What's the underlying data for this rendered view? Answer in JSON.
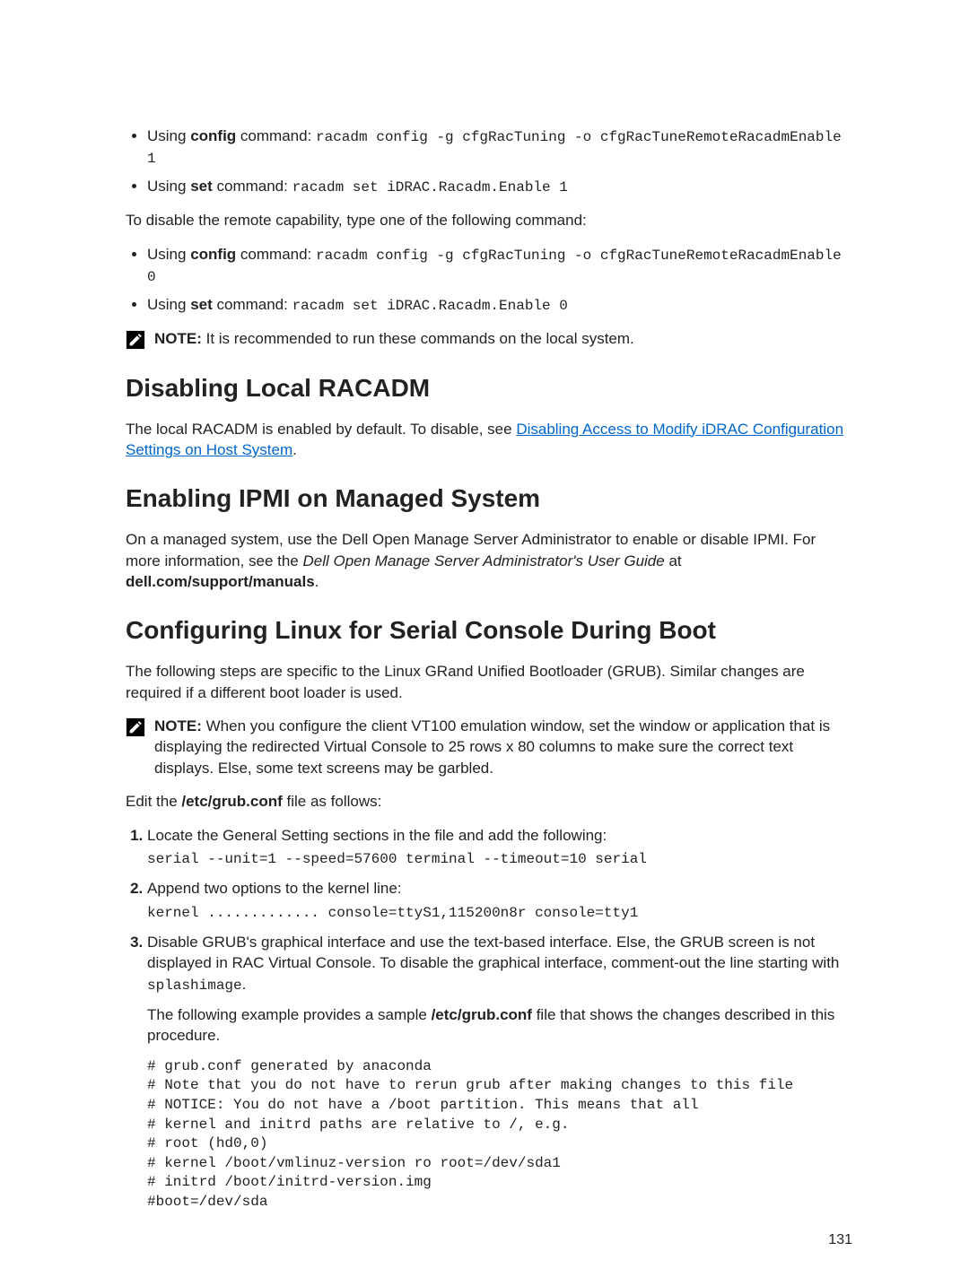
{
  "bullets_enable": [
    {
      "lead": "Using ",
      "cmd": "config",
      "rest": " command: ",
      "code": "racadm config -g cfgRacTuning -o cfgRacTuneRemoteRacadmEnable 1"
    },
    {
      "lead": "Using ",
      "cmd": "set",
      "rest": " command: ",
      "code": "racadm set iDRAC.Racadm.Enable 1"
    }
  ],
  "disable_intro": "To disable the remote capability, type one of the following command:",
  "bullets_disable": [
    {
      "lead": "Using ",
      "cmd": "config",
      "rest": " command: ",
      "code": "racadm config -g cfgRacTuning -o cfgRacTuneRemoteRacadmEnable 0"
    },
    {
      "lead": "Using ",
      "cmd": "set",
      "rest": " command: ",
      "code": "racadm set iDRAC.Racadm.Enable 0"
    }
  ],
  "note1": {
    "label": "NOTE:",
    "text": " It is recommended to run these commands on the local system."
  },
  "section1": {
    "title": "Disabling Local RACADM",
    "body_pre": "The local RACADM is enabled by default. To disable, see ",
    "link": "Disabling Access to Modify iDRAC Configuration Settings on Host System",
    "body_post": "."
  },
  "section2": {
    "title": "Enabling IPMI on Managed System",
    "body_pre": "On a managed system, use the Dell Open Manage Server Administrator to enable or disable IPMI. For more information, see the ",
    "italic": "Dell Open Manage Server Administrator's User Guide",
    "body_mid": " at ",
    "bold": "dell.com/support/manuals",
    "body_post": "."
  },
  "section3": {
    "title": "Configuring Linux for Serial Console During Boot",
    "intro": "The following steps are specific to the Linux GRand Unified Bootloader (GRUB). Similar changes are required if a different boot loader is used.",
    "note": {
      "label": "NOTE:",
      "text": " When you configure the client VT100 emulation window, set the window or application that is displaying the redirected Virtual Console to 25 rows x 80 columns to make sure the correct text displays. Else, some text screens may be garbled."
    },
    "edit_pre": "Edit the ",
    "edit_file": "/etc/grub.conf",
    "edit_post": " file as follows:",
    "steps": [
      {
        "text": "Locate the General Setting sections in the file and add the following:",
        "code": "serial --unit=1 --speed=57600 terminal --timeout=10 serial"
      },
      {
        "text": "Append two options to the kernel line:",
        "code": "kernel ............. console=ttyS1,115200n8r console=tty1"
      },
      {
        "text_pre": "Disable GRUB's graphical interface and use the text-based interface. Else, the GRUB screen is not displayed in RAC Virtual Console. To disable the graphical interface, comment-out the line starting with ",
        "code_inline": "splashimage",
        "text_post": ".",
        "para2_pre": "The following example provides a sample ",
        "para2_file": "/etc/grub.conf",
        "para2_post": " file that shows the changes described in this procedure.",
        "block": "# grub.conf generated by anaconda\n# Note that you do not have to rerun grub after making changes to this file\n# NOTICE: You do not have a /boot partition. This means that all\n# kernel and initrd paths are relative to /, e.g.\n# root (hd0,0)\n# kernel /boot/vmlinuz-version ro root=/dev/sda1\n# initrd /boot/initrd-version.img\n#boot=/dev/sda"
      }
    ]
  },
  "page_number": "131"
}
